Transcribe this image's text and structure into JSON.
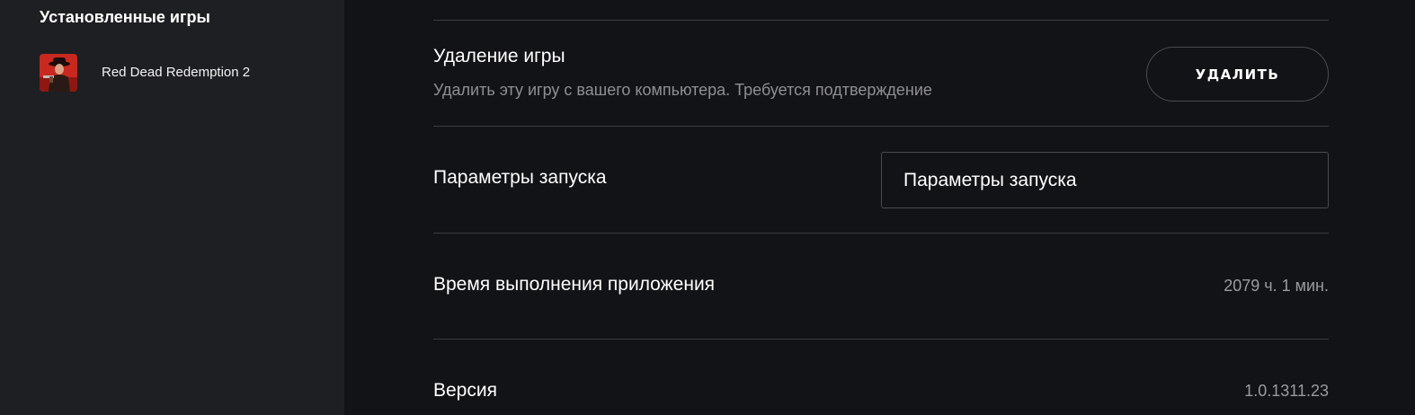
{
  "sidebar": {
    "title": "Установленные игры",
    "games": [
      {
        "name": "Red Dead Redemption 2",
        "icon": "rdr2-cover-thumbnail"
      }
    ]
  },
  "settings": {
    "uninstall": {
      "title": "Удаление игры",
      "description": "Удалить эту игру с вашего компьютера. Требуется подтверждение",
      "button_label": "УДАЛИТЬ"
    },
    "launch_params": {
      "title": "Параметры запуска",
      "placeholder": "Параметры запуска",
      "value": ""
    },
    "runtime": {
      "title": "Время выполнения приложения",
      "value": "2079 ч. 1 мин."
    },
    "version": {
      "title": "Версия",
      "value": "1.0.1311.23"
    }
  },
  "colors": {
    "sidebar_bg": "#1e1f22",
    "main_bg": "#121316",
    "divider": "#3a3b3f",
    "muted_text": "#8e8f93",
    "accent_red": "#c8281f"
  }
}
